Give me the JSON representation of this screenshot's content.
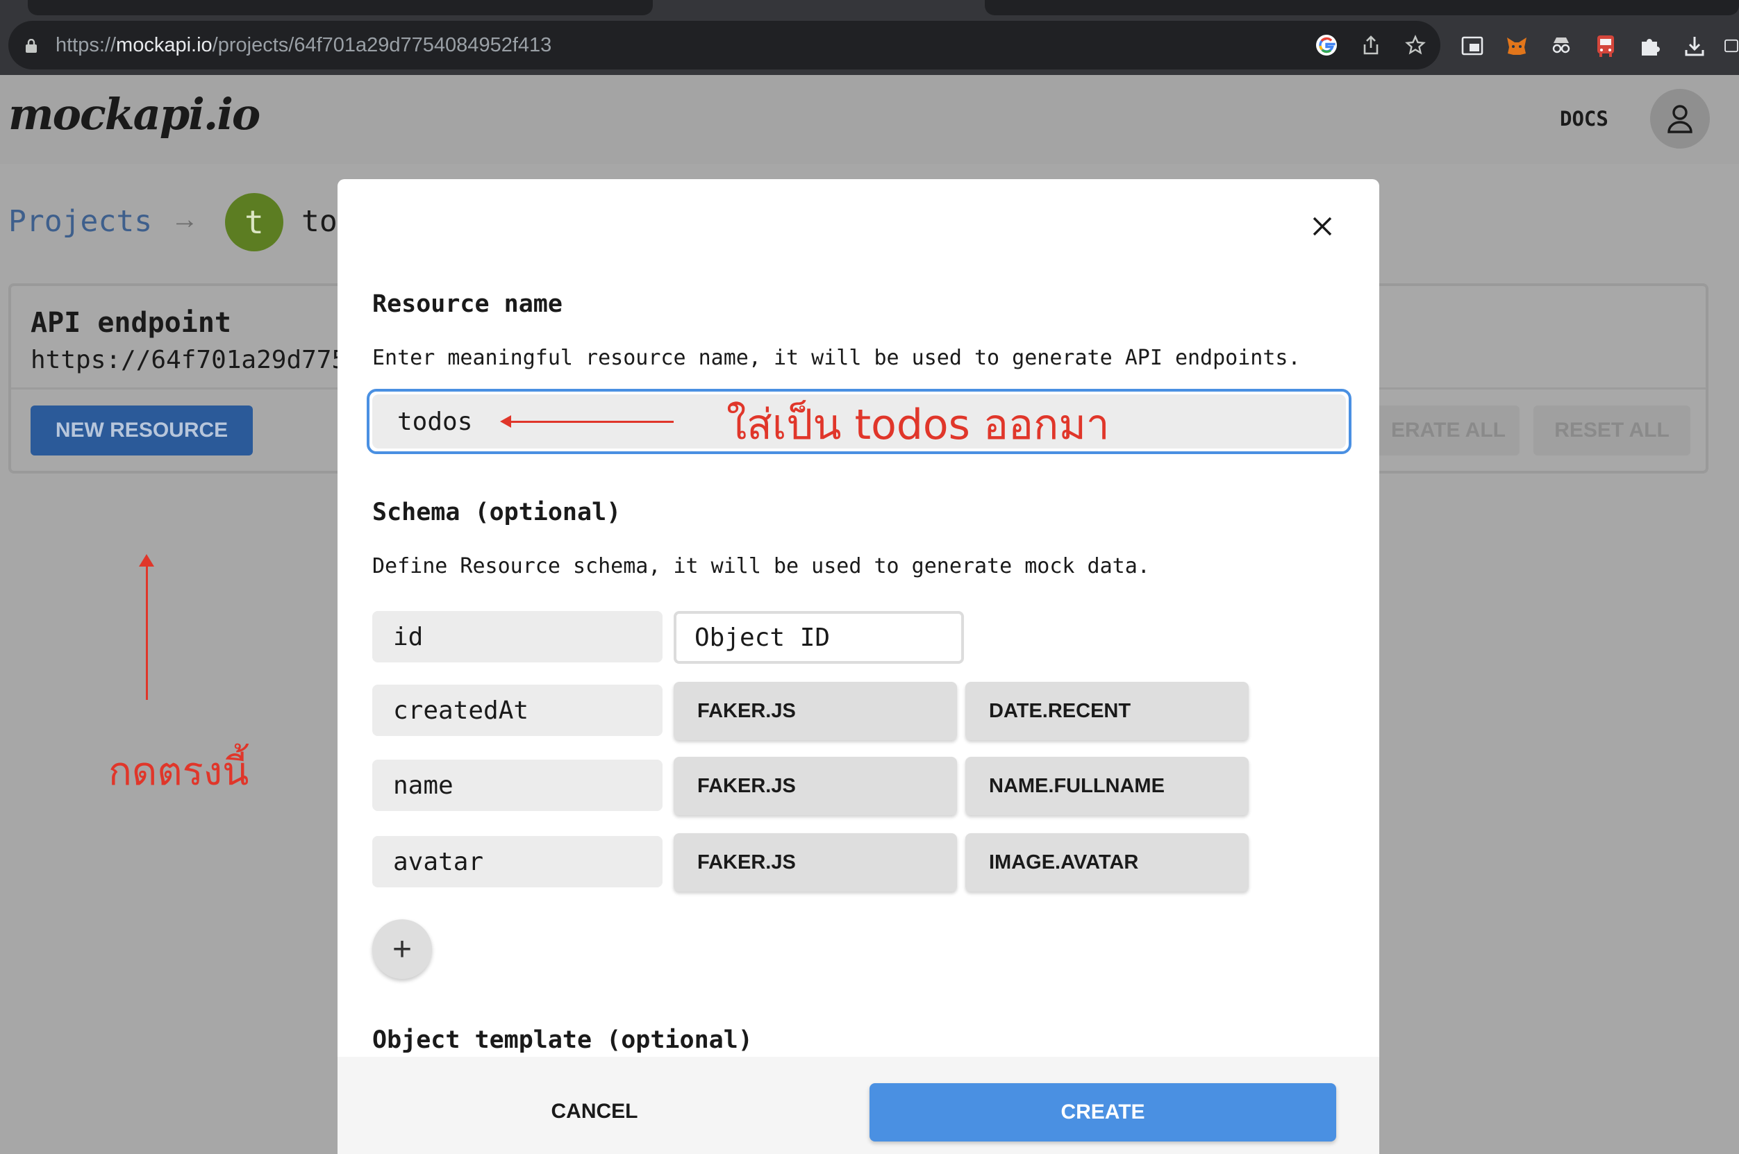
{
  "browser": {
    "url_scheme": "https://",
    "url_host": "mockapi.io",
    "url_path": "/projects/64f701a29d7754084952f413",
    "toolbar_icons": [
      "google-icon",
      "share-icon",
      "star-icon"
    ],
    "extension_icons": [
      "picture-in-picture-icon",
      "metamask-icon",
      "spy-icon",
      "bus-icon",
      "puzzle-icon",
      "download-icon",
      "side-panel-icon"
    ]
  },
  "header": {
    "logo": "mockapi.io",
    "docs_label": "DOCS",
    "account_icon": "user-icon"
  },
  "breadcrumb": {
    "projects_label": "Projects",
    "arrow": "→",
    "project_initial": "t",
    "project_name_visible": "to"
  },
  "api_card": {
    "title": "API endpoint",
    "url_visible": "https://64f701a29d775",
    "new_resource_label": "NEW RESOURCE",
    "generate_all_visible": "ERATE ALL",
    "reset_all_label": "RESET ALL"
  },
  "annotations": {
    "press_here": "กดตรงนี้",
    "fill_todos": "ใส่เป็น todos ออกมา",
    "color": "#e0362a"
  },
  "modal": {
    "resource_name_title": "Resource name",
    "resource_name_desc": "Enter meaningful resource name, it will be used to generate API endpoints.",
    "resource_name_value": "todos",
    "schema_title": "Schema (optional)",
    "schema_desc": "Define Resource schema, it will be used to generate mock data.",
    "schema_fields": [
      {
        "name": "id",
        "type": "Object ID"
      },
      {
        "name": "createdAt",
        "type": "FAKER.JS",
        "method": "DATE.RECENT"
      },
      {
        "name": "name",
        "type": "FAKER.JS",
        "method": "NAME.FULLNAME"
      },
      {
        "name": "avatar",
        "type": "FAKER.JS",
        "method": "IMAGE.AVATAR"
      }
    ],
    "add_field_symbol": "+",
    "object_template_title": "Object template (optional)",
    "cancel_label": "CANCEL",
    "create_label": "CREATE",
    "accent_color": "#4a90e2"
  }
}
